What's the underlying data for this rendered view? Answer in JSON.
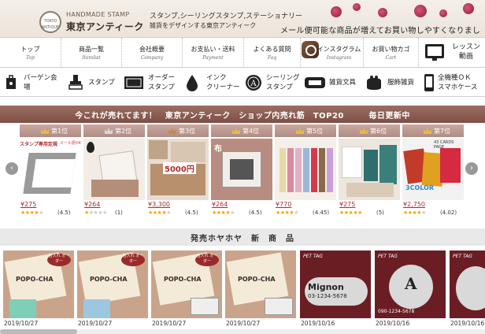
{
  "header": {
    "logo_badge": "TOKYO ANTIQUE",
    "logo_sub": "HANDMADE STAMP",
    "logo_main": "東京アンティーク",
    "tagline1": "スタンプ,シーリングスタンプ,ステーショナリー",
    "tagline2": "雑貨をデザインする東京アンティーク",
    "slogan": "メール便可能な商品が増えてお買い物しやすくなりました"
  },
  "nav": [
    {
      "ja": "トップ",
      "en": "Top"
    },
    {
      "ja": "商品一覧",
      "en": "Itemlist"
    },
    {
      "ja": "会社概要",
      "en": "Company"
    },
    {
      "ja": "お支払い・送料",
      "en": "Payment"
    },
    {
      "ja": "よくある質問",
      "en": "Faq"
    },
    {
      "ja": "インスタグラム",
      "en": "Instagram"
    },
    {
      "ja": "お買い物カゴ",
      "en": "Cart"
    }
  ],
  "lesson": {
    "line1": "レッスン",
    "line2": "動画"
  },
  "categories": [
    {
      "label": "バーゲン会場",
      "icon": "price-tag-icon"
    },
    {
      "label": "スタンプ",
      "icon": "stamp-icon"
    },
    {
      "label": "オーダー\nスタンプ",
      "icon": "order-stamp-icon"
    },
    {
      "label": "インク\nクリーナー",
      "icon": "ink-drop-icon"
    },
    {
      "label": "シーリング\nスタンプ",
      "icon": "seal-icon"
    },
    {
      "label": "雑貨文具",
      "icon": "tape-icon"
    },
    {
      "label": "服飾雑貨",
      "icon": "purse-icon"
    },
    {
      "label": "全機種ＯＫ\nスマホケース",
      "icon": "phone-case-icon"
    }
  ],
  "ranking": {
    "title": "今これが売れてます！　東京アンティーク　ショップ内売れ筋　TOP20　　　毎日更新中",
    "items": [
      {
        "rank": "第1位",
        "price": "¥275",
        "rating": "(4.5)",
        "stars": 4.5,
        "badge": "スタンプ専用定規",
        "badge2": "メール便OK"
      },
      {
        "rank": "第2位",
        "price": "¥264",
        "rating": "(1)",
        "stars": 1
      },
      {
        "rank": "第3位",
        "price": "¥3,300",
        "rating": "(4.5)",
        "stars": 4.5,
        "badge": "5000円"
      },
      {
        "rank": "第4位",
        "price": "¥264",
        "rating": "(4.5)",
        "stars": 4.5,
        "badge": "布"
      },
      {
        "rank": "第5位",
        "price": "¥770",
        "rating": "(4.45)",
        "stars": 4.45
      },
      {
        "rank": "第6位",
        "price": "¥275",
        "rating": "(5)",
        "stars": 5
      },
      {
        "rank": "第7位",
        "price": "¥2,750",
        "rating": "(4.02)",
        "stars": 4.02,
        "badge": "43 CARDS PAGE",
        "badge2": "3COLOR"
      }
    ]
  },
  "new_arrivals": {
    "title": "発売ホヤホヤ　新　商　品",
    "items": [
      {
        "date": "2019/10/27",
        "text": "POPO-CHA",
        "sub": "名入れ オーダー"
      },
      {
        "date": "2019/10/27",
        "text": "POPO-CHA",
        "sub": "名入れ オーダー"
      },
      {
        "date": "2019/10/27",
        "text": "POPO-CHA",
        "sub": "名入れ オーダー"
      },
      {
        "date": "2019/10/27",
        "text": "POPO-CHA",
        "sub": ""
      },
      {
        "date": "2019/10/16",
        "text": "Mignon",
        "sub": "03-1234-5678",
        "tag": "PET TAG"
      },
      {
        "date": "2019/10/16",
        "text": "A",
        "sub": "090-1234-5678",
        "tag": "PET TAG"
      },
      {
        "date": "2019/10/16",
        "text": "",
        "sub": "",
        "tag": "PET TAG"
      }
    ]
  },
  "colors": {
    "accent": "#8a5a50",
    "price": "#b02a2a",
    "star": "#f2a20a"
  }
}
